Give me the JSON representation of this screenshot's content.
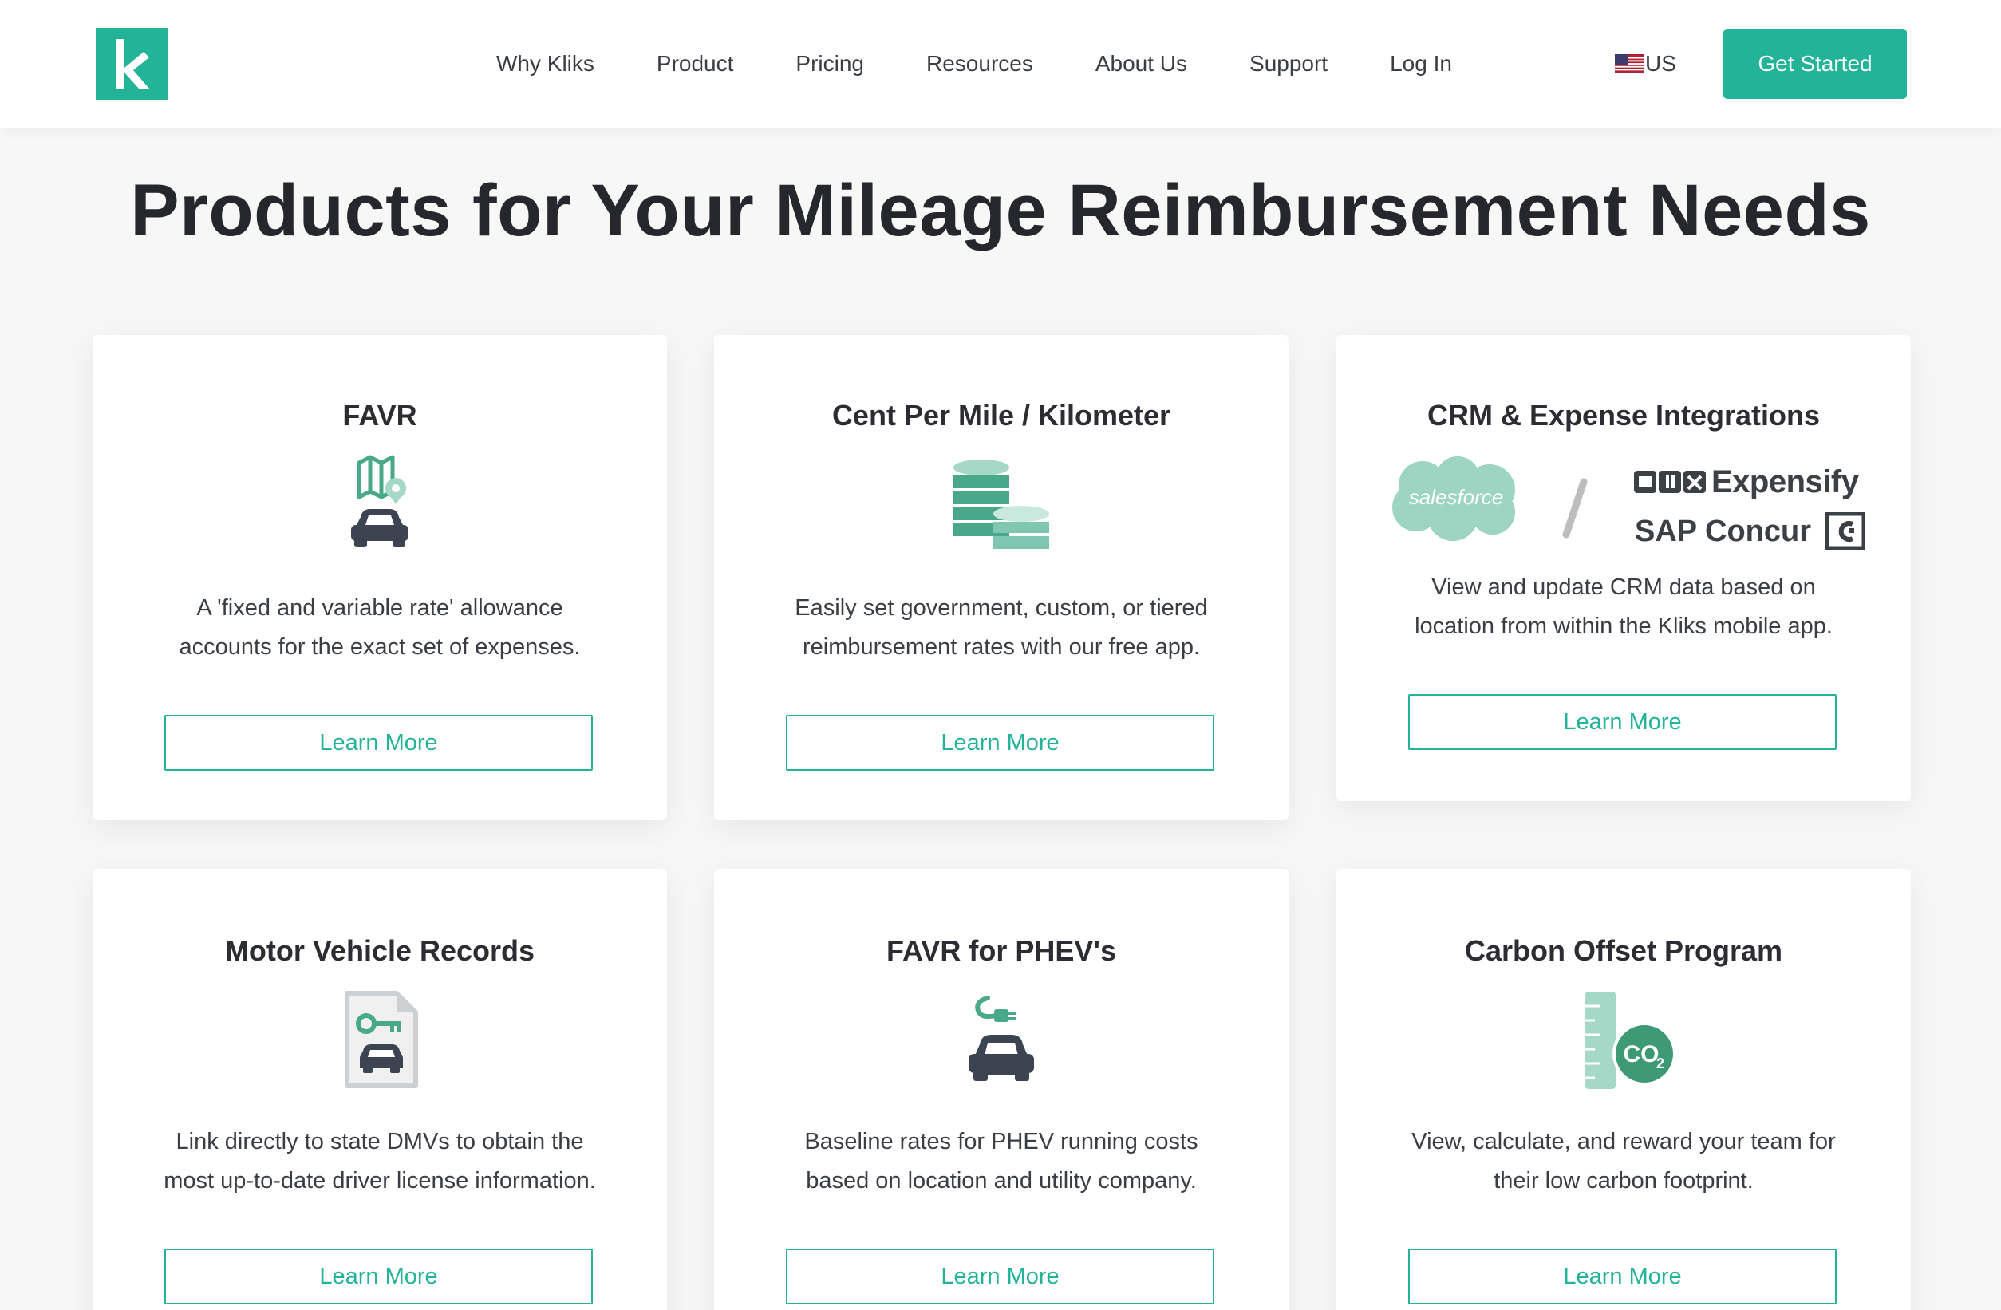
{
  "nav": {
    "logo_letter": "k",
    "links": [
      "Why Kliks",
      "Product",
      "Pricing",
      "Resources",
      "About Us",
      "Support",
      "Log In"
    ],
    "locale": "US",
    "cta": "Get Started"
  },
  "page_title": "Products for Your Mileage Reimbursement Needs",
  "cards": [
    {
      "title": "FAVR",
      "icon": "map-car-icon",
      "desc": [
        "A 'fixed and variable rate' allowance",
        "accounts for the exact set of expenses."
      ],
      "button": "Learn More"
    },
    {
      "title": "Cent Per Mile / Kilometer",
      "icon": "coins-icon",
      "desc": [
        "Easily set government, custom, or tiered",
        "reimbursement rates with our free app."
      ],
      "button": "Learn More"
    },
    {
      "title": "CRM & Expense Integrations",
      "icon": "integrations-logos",
      "logos": {
        "salesforce": "salesforce",
        "expensify": "Expensify",
        "concur": "SAP Concur"
      },
      "desc": [
        "View and update CRM data based on",
        "location from within the Kliks mobile app."
      ],
      "button": "Learn More"
    },
    {
      "title": "Motor Vehicle Records",
      "icon": "license-document-icon",
      "desc": [
        "Link directly to state DMVs to obtain the",
        "most up-to-date driver license information."
      ],
      "button": "Learn More"
    },
    {
      "title": "FAVR for PHEV's",
      "icon": "electric-car-icon",
      "desc": [
        "Baseline rates for PHEV running costs",
        "based on location and utility company."
      ],
      "button": "Learn More"
    },
    {
      "title": "Carbon Offset Program",
      "icon": "co2-ruler-icon",
      "desc": [
        "View, calculate, and reward your team for",
        "their low carbon footprint."
      ],
      "button": "Learn More"
    }
  ],
  "colors": {
    "brand": "#22b398",
    "icon_dark": "#3b4450",
    "icon_light": "#a6d8c8",
    "text": "#2b2d33"
  }
}
